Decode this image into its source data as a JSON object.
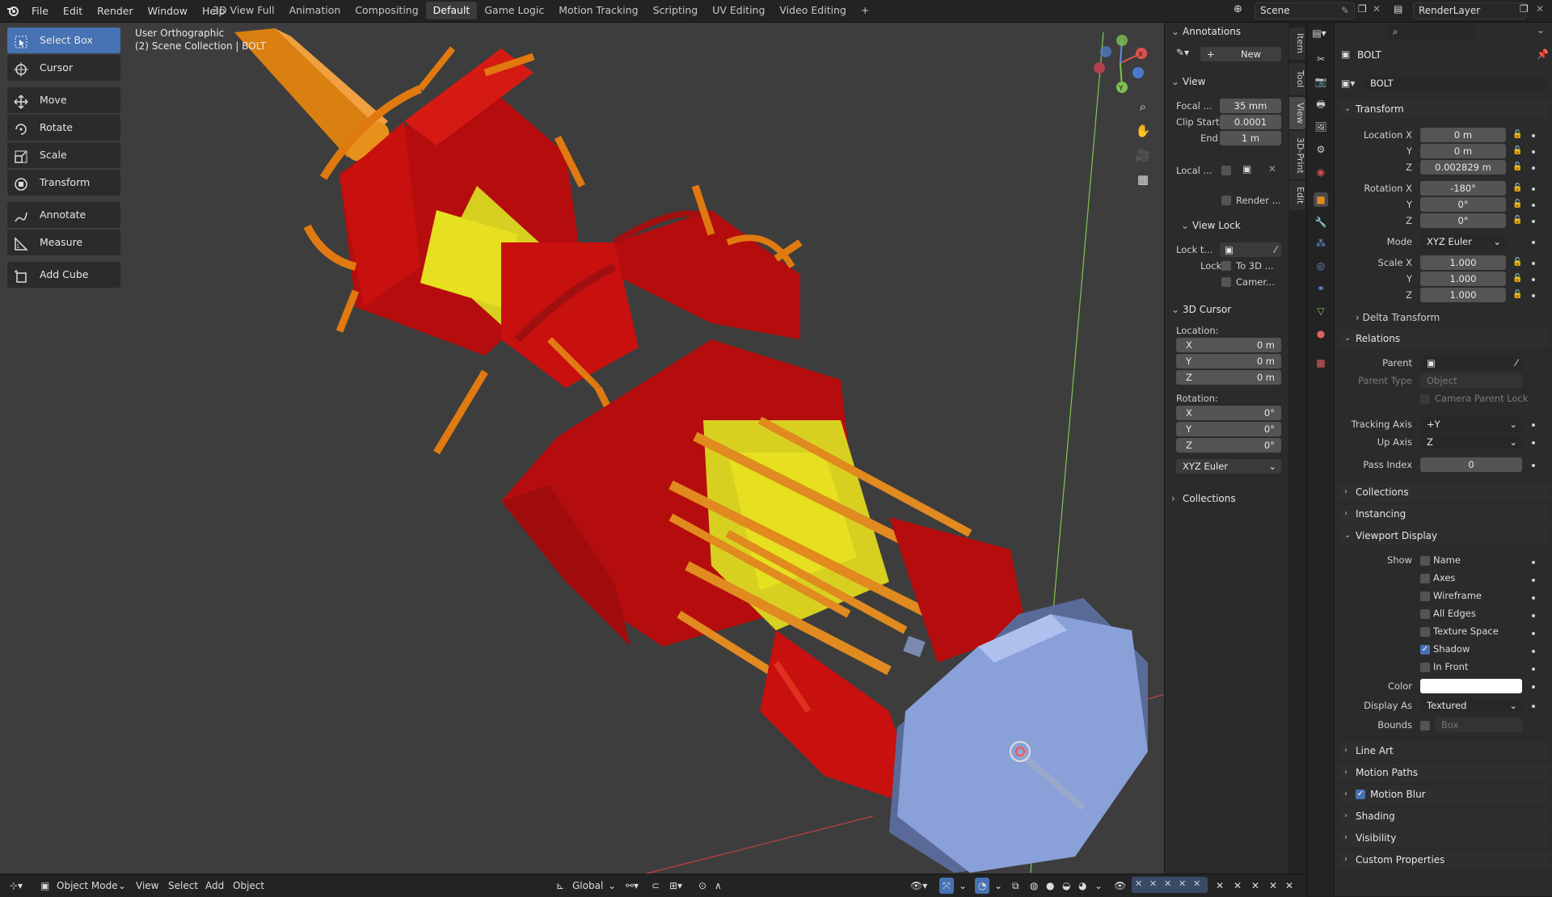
{
  "topbar": {
    "menus": [
      "File",
      "Edit",
      "Render",
      "Window",
      "Help"
    ],
    "workspaces": [
      "3D View Full",
      "Animation",
      "Compositing",
      "Default",
      "Game Logic",
      "Motion Tracking",
      "Scripting",
      "UV Editing",
      "Video Editing"
    ],
    "active_workspace": "Default",
    "add_tab": "+",
    "scene": "Scene",
    "render_layer": "RenderLayer"
  },
  "viewport": {
    "view_name": "User Orthographic",
    "collection_info": "(2) Scene Collection | BOLT",
    "tools": [
      {
        "label": "Select Box",
        "icon": "select-box-icon",
        "active": true
      },
      {
        "label": "Cursor",
        "icon": "cursor-icon"
      },
      {
        "label": "Move",
        "icon": "move-icon"
      },
      {
        "label": "Rotate",
        "icon": "rotate-icon"
      },
      {
        "label": "Scale",
        "icon": "scale-icon"
      },
      {
        "label": "Transform",
        "icon": "transform-icon"
      },
      {
        "label": "Annotate",
        "icon": "annotate-icon"
      },
      {
        "label": "Measure",
        "icon": "measure-icon"
      },
      {
        "label": "Add Cube",
        "icon": "add-cube-icon"
      }
    ],
    "gizmo": {
      "x": "X",
      "y": "Y",
      "z": "Z"
    }
  },
  "npanel": {
    "annotations": {
      "title": "Annotations",
      "new_label": "New"
    },
    "view": {
      "title": "View",
      "focal_label": "Focal ...",
      "focal_value": "35 mm",
      "clip_start_label": "Clip Start",
      "clip_start_value": "0.0001",
      "end_label": "End",
      "end_value": "1 m",
      "local_label": "Local ...",
      "render_label": "Render ..."
    },
    "view_lock": {
      "title": "View Lock",
      "lock_to_label": "Lock t...",
      "lock_label": "Lock",
      "to3d_label": "To 3D ...",
      "camera_label": "Camer..."
    },
    "cursor": {
      "title": "3D Cursor",
      "location_label": "Location:",
      "loc": [
        {
          "axis": "X",
          "value": "0 m"
        },
        {
          "axis": "Y",
          "value": "0 m"
        },
        {
          "axis": "Z",
          "value": "0 m"
        }
      ],
      "rotation_label": "Rotation:",
      "rot": [
        {
          "axis": "X",
          "value": "0°"
        },
        {
          "axis": "Y",
          "value": "0°"
        },
        {
          "axis": "Z",
          "value": "0°"
        }
      ],
      "mode": "XYZ Euler"
    },
    "collections": {
      "title": "Collections"
    },
    "tabs": [
      "Item",
      "Tool",
      "View",
      "3D-Print",
      "Edit"
    ]
  },
  "props": {
    "object_name": "BOLT",
    "object_field": "BOLT",
    "transform": {
      "title": "Transform",
      "location_x_label": "Location X",
      "location_x": "0 m",
      "location_y_label": "Y",
      "location_y": "0 m",
      "location_z_label": "Z",
      "location_z": "0.002829 m",
      "rotation_x_label": "Rotation X",
      "rotation_x": "-180°",
      "rotation_y_label": "Y",
      "rotation_y": "0°",
      "rotation_z_label": "Z",
      "rotation_z": "0°",
      "mode_label": "Mode",
      "mode": "XYZ Euler",
      "scale_x_label": "Scale X",
      "scale_x": "1.000",
      "scale_y_label": "Y",
      "scale_y": "1.000",
      "scale_z_label": "Z",
      "scale_z": "1.000",
      "delta_label": "Delta Transform"
    },
    "relations": {
      "title": "Relations",
      "parent_label": "Parent",
      "parent_type_label": "Parent Type",
      "parent_type": "Object",
      "camera_parent_lock": "Camera Parent Lock",
      "tracking_axis_label": "Tracking Axis",
      "tracking_axis": "+Y",
      "up_axis_label": "Up Axis",
      "up_axis": "Z",
      "pass_index_label": "Pass Index",
      "pass_index": "0"
    },
    "collections_title": "Collections",
    "instancing_title": "Instancing",
    "viewport_display": {
      "title": "Viewport Display",
      "show_label": "Show",
      "options": [
        {
          "label": "Name",
          "checked": false
        },
        {
          "label": "Axes",
          "checked": false
        },
        {
          "label": "Wireframe",
          "checked": false
        },
        {
          "label": "All Edges",
          "checked": false
        },
        {
          "label": "Texture Space",
          "checked": false
        },
        {
          "label": "Shadow",
          "checked": true
        },
        {
          "label": "In Front",
          "checked": false
        }
      ],
      "color_label": "Color",
      "color_value": "#ffffff",
      "display_as_label": "Display As",
      "display_as": "Textured",
      "bounds_label": "Bounds",
      "bounds_value": "Box"
    },
    "collapsed_panels": [
      "Line Art",
      "Motion Paths",
      "Motion Blur",
      "Shading",
      "Visibility",
      "Custom Properties"
    ]
  },
  "bottombar": {
    "mode": "Object Mode",
    "menus": [
      "View",
      "Select",
      "Add",
      "Object"
    ],
    "orientation": "Global"
  },
  "colors": {
    "accent": "#4772b3",
    "viewport_bg": "#3d3d3d",
    "panel_bg": "#2b2b2b",
    "model_red": "#c8100e",
    "model_orange": "#e07a10",
    "model_yellow": "#e6e020",
    "model_blue": "#8aa0d8"
  }
}
